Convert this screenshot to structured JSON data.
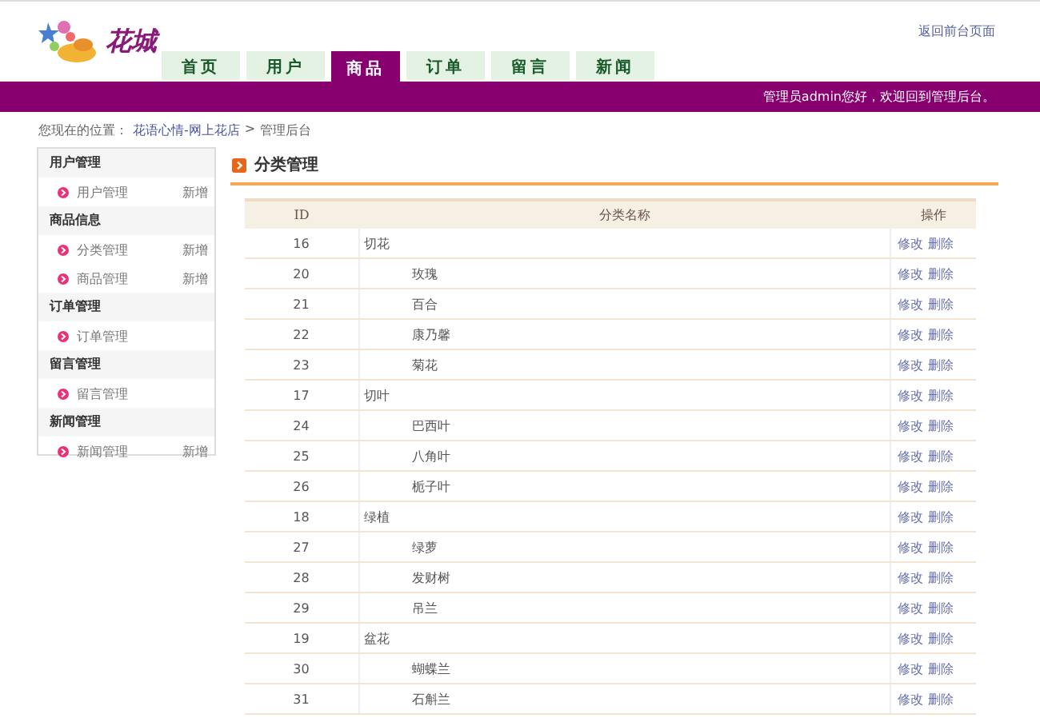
{
  "logo": {
    "text": "花城"
  },
  "top_link": "返回前台页面",
  "tabs": [
    {
      "label": "首页",
      "selected": false
    },
    {
      "label": "用户",
      "selected": false
    },
    {
      "label": "商品",
      "selected": true
    },
    {
      "label": "订单",
      "selected": false
    },
    {
      "label": "留言",
      "selected": false
    },
    {
      "label": "新闻",
      "selected": false
    }
  ],
  "welcome": "管理员admin您好，欢迎回到管理后台。",
  "breadcrumb": {
    "prefix": "您现在的位置：",
    "link": "花语心情-网上花店",
    "separator": ">",
    "current": "管理后台"
  },
  "sidebar": [
    {
      "title": "用户管理",
      "items": [
        {
          "label": "用户管理",
          "action": "新增"
        }
      ]
    },
    {
      "title": "商品信息",
      "items": [
        {
          "label": "分类管理",
          "action": "新增"
        },
        {
          "label": "商品管理",
          "action": "新增"
        }
      ]
    },
    {
      "title": "订单管理",
      "items": [
        {
          "label": "订单管理"
        }
      ]
    },
    {
      "title": "留言管理",
      "items": [
        {
          "label": "留言管理"
        }
      ]
    },
    {
      "title": "新闻管理",
      "items": [
        {
          "label": "新闻管理",
          "action": "新增"
        }
      ]
    }
  ],
  "section_title": "分类管理",
  "table": {
    "columns": [
      "ID",
      "分类名称",
      "操作"
    ],
    "rows": [
      {
        "id": "16",
        "name": "切花",
        "actions": [
          "修改",
          "删除"
        ],
        "children": [
          {
            "id": "20",
            "name": "玫瑰",
            "actions": [
              "修改",
              "删除"
            ]
          },
          {
            "id": "21",
            "name": "百合",
            "actions": [
              "修改",
              "删除"
            ]
          },
          {
            "id": "22",
            "name": "康乃馨",
            "actions": [
              "修改",
              "删除"
            ]
          },
          {
            "id": "23",
            "name": "菊花",
            "actions": [
              "修改",
              "删除"
            ]
          }
        ]
      },
      {
        "id": "17",
        "name": "切叶",
        "actions": [
          "修改",
          "删除"
        ],
        "children": [
          {
            "id": "24",
            "name": "巴西叶",
            "actions": [
              "修改",
              "删除"
            ]
          },
          {
            "id": "25",
            "name": "八角叶",
            "actions": [
              "修改",
              "删除"
            ]
          },
          {
            "id": "26",
            "name": "栀子叶",
            "actions": [
              "修改",
              "删除"
            ]
          }
        ]
      },
      {
        "id": "18",
        "name": "绿植",
        "actions": [
          "修改",
          "删除"
        ],
        "children": [
          {
            "id": "27",
            "name": "绿萝",
            "actions": [
              "修改",
              "删除"
            ]
          },
          {
            "id": "28",
            "name": "发财树",
            "actions": [
              "修改",
              "删除"
            ]
          },
          {
            "id": "29",
            "name": "吊兰",
            "actions": [
              "修改",
              "删除"
            ]
          }
        ]
      },
      {
        "id": "19",
        "name": "盆花",
        "actions": [
          "修改",
          "删除"
        ],
        "children": [
          {
            "id": "30",
            "name": "蝴蝶兰",
            "actions": [
              "修改",
              "删除"
            ]
          },
          {
            "id": "31",
            "name": "石斛兰",
            "actions": [
              "修改",
              "删除"
            ]
          }
        ]
      }
    ]
  }
}
